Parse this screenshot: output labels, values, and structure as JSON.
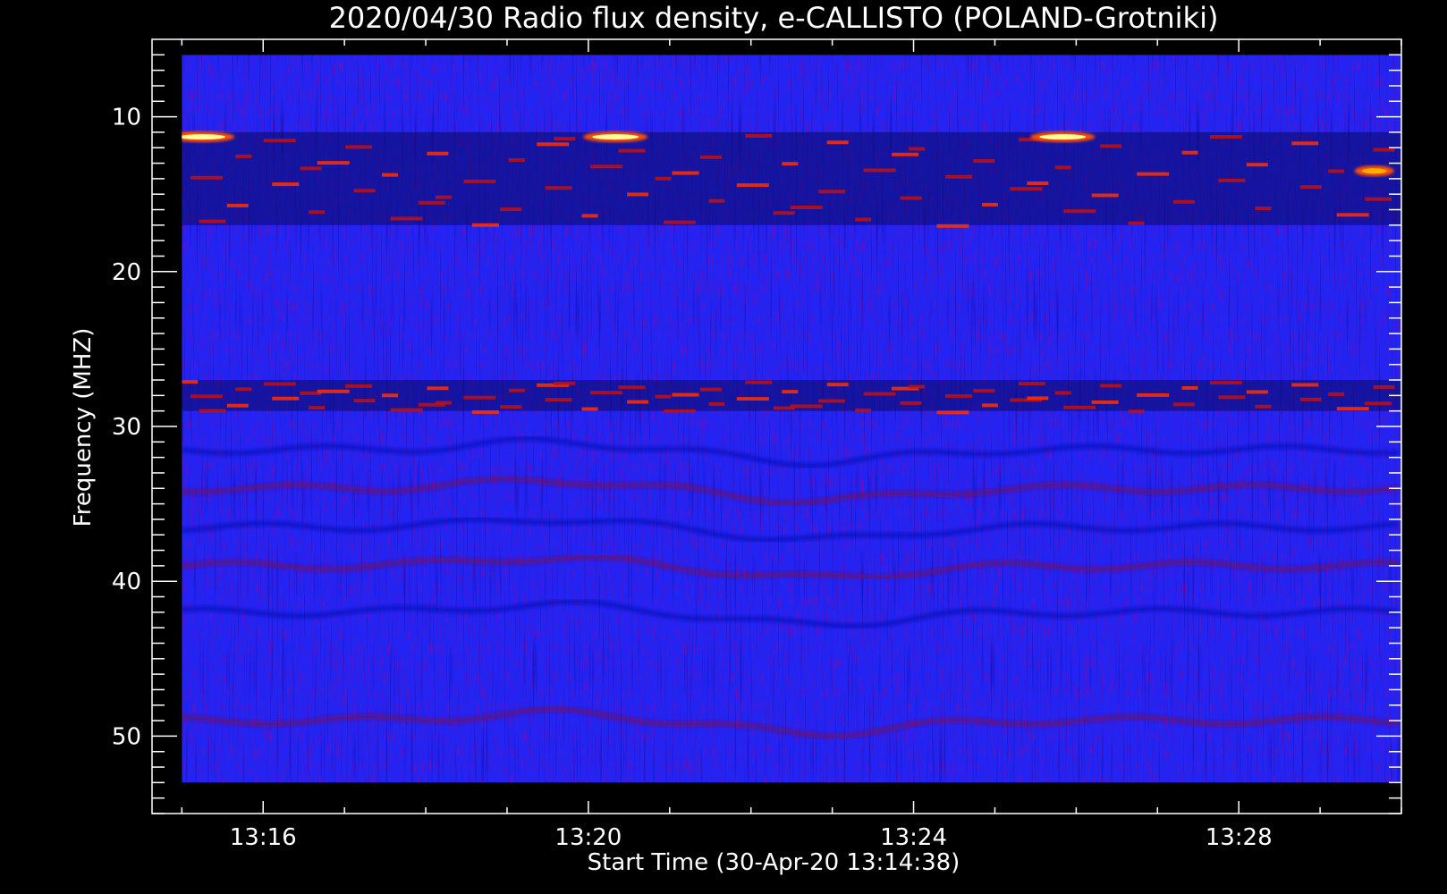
{
  "chart_data": {
    "type": "heatmap",
    "title": "2020/04/30  Radio flux density, e-CALLISTO (POLAND-Grotniki)",
    "xlabel": "Start Time (30-Apr-20 13:14:38)",
    "ylabel": "Frequency (MHZ)",
    "x_tick_labels": [
      "13:16",
      "13:20",
      "13:24",
      "13:28"
    ],
    "y_tick_labels": [
      "10",
      "20",
      "30",
      "40",
      "50"
    ],
    "xlim_minutes": [
      "13:14:38",
      "13:30:00"
    ],
    "ylim_mhz": [
      55,
      5
    ],
    "y_axis_inverted": true,
    "data_time_range": [
      "13:15:00",
      "13:30:00"
    ],
    "data_freq_range_mhz": [
      6,
      53
    ],
    "colormap": [
      "#000000",
      "#1a1aff",
      "#3333ff",
      "#8b0000",
      "#ff2000",
      "#ff8000",
      "#ffff66",
      "#ffffff"
    ],
    "features": [
      {
        "kind": "bright-burst",
        "time": "13:15:15",
        "freq_mhz": 11.3
      },
      {
        "kind": "bright-burst",
        "time": "13:20:20",
        "freq_mhz": 11.3
      },
      {
        "kind": "bright-burst",
        "time": "13:25:50",
        "freq_mhz": 11.3
      },
      {
        "kind": "burst",
        "time": "13:29:40",
        "freq_mhz": 13.5
      },
      {
        "kind": "interference-band",
        "freq_mhz_range": [
          11,
          17
        ]
      },
      {
        "kind": "interference-band",
        "freq_mhz_range": [
          27,
          29
        ]
      }
    ]
  }
}
